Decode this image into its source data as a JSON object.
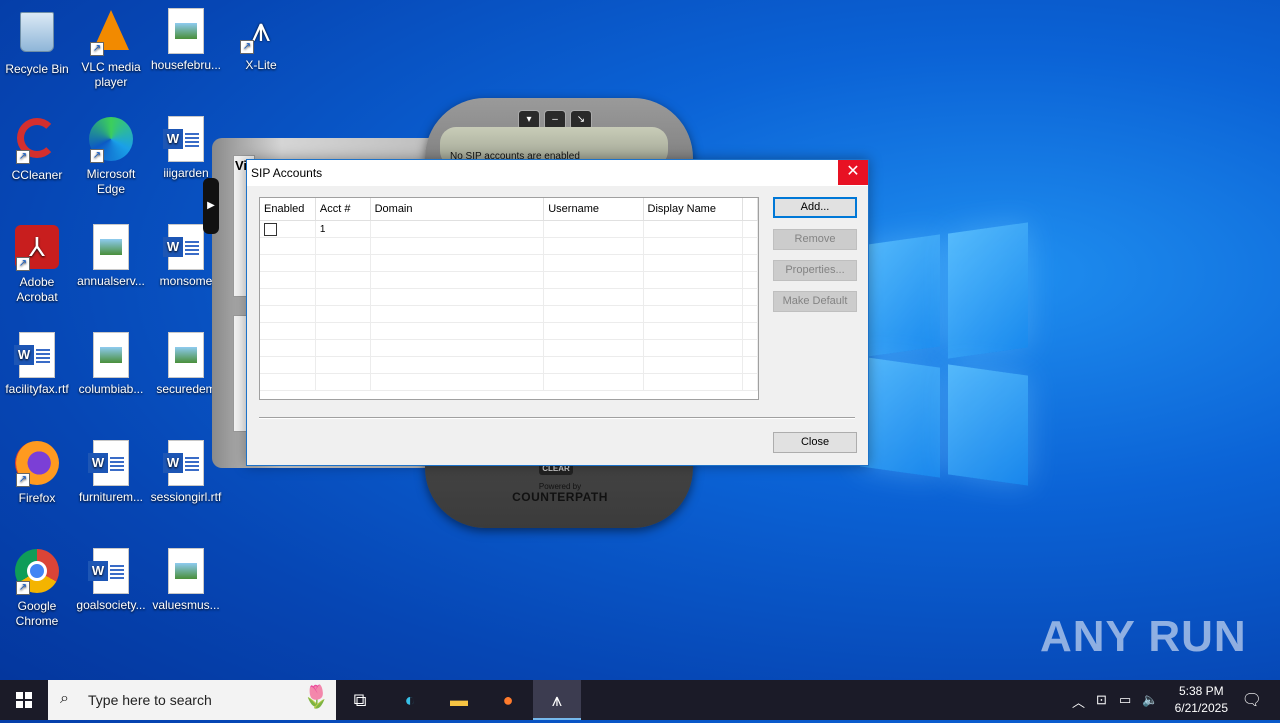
{
  "desktop": {
    "icons": [
      {
        "label": "Recycle Bin",
        "icon": "recycle-bin-icon"
      },
      {
        "label": "VLC media player",
        "icon": "vlc-icon"
      },
      {
        "label": "housefebru...",
        "icon": "image-file-icon"
      },
      {
        "label": "X-Lite",
        "icon": "xlite-icon"
      },
      {
        "label": "CCleaner",
        "icon": "ccleaner-icon"
      },
      {
        "label": "Microsoft Edge",
        "icon": "edge-icon"
      },
      {
        "label": "iiigarden",
        "icon": "word-doc-icon"
      },
      {
        "label": "Adobe Acrobat",
        "icon": "acrobat-icon"
      },
      {
        "label": "annualserv...",
        "icon": "image-file-icon"
      },
      {
        "label": "monsome",
        "icon": "word-doc-icon"
      },
      {
        "label": "facilityfax.rtf",
        "icon": "word-doc-icon"
      },
      {
        "label": "columbiab...",
        "icon": "image-file-icon"
      },
      {
        "label": "securedem",
        "icon": "image-file-icon"
      },
      {
        "label": "Firefox",
        "icon": "firefox-icon"
      },
      {
        "label": "furniturem...",
        "icon": "word-doc-icon"
      },
      {
        "label": "sessiongirl.rtf",
        "icon": "word-doc-icon"
      },
      {
        "label": "Google Chrome",
        "icon": "chrome-icon"
      },
      {
        "label": "goalsociety...",
        "icon": "word-doc-icon"
      },
      {
        "label": "valuesmus...",
        "icon": "image-file-icon"
      }
    ],
    "watermark": "ANY RUN"
  },
  "xlite": {
    "status": "No SIP accounts are enabled",
    "side_label": "Vi",
    "clear_label": "CLEAR",
    "powered_label": "Powered by",
    "brand_label": "COUNTERPATH"
  },
  "dialog": {
    "title": "SIP Accounts",
    "columns": [
      "Enabled",
      "Acct #",
      "Domain",
      "Username",
      "Display Name"
    ],
    "rows": [
      {
        "enabled": false,
        "acct": "1",
        "domain": "",
        "username": "",
        "display_name": ""
      }
    ],
    "buttons": {
      "add": "Add...",
      "remove": "Remove",
      "properties": "Properties...",
      "make_default": "Make Default",
      "close": "Close"
    },
    "close_glyph": "✕"
  },
  "taskbar": {
    "search_placeholder": "Type here to search",
    "time": "5:38 PM",
    "date": "6/21/2025"
  },
  "colors": {
    "dialog_close": "#e81123",
    "primary_border": "#0078d7",
    "taskbar": "#1b1b28"
  }
}
